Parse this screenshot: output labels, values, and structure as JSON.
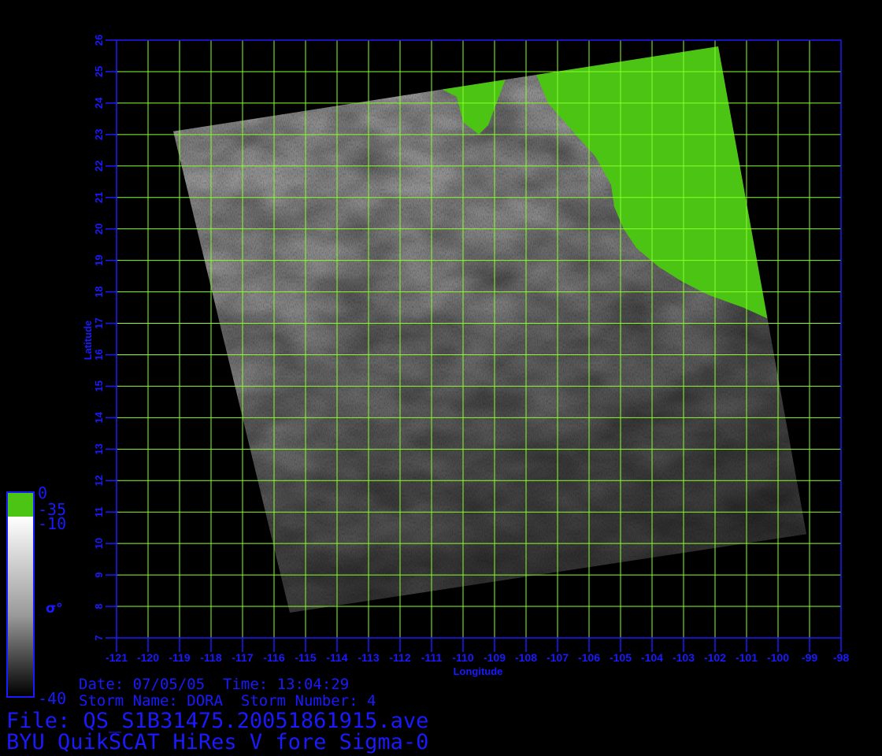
{
  "map": {
    "lon_ticks": [
      "-121",
      "-120",
      "-119",
      "-118",
      "-117",
      "-116",
      "-115",
      "-114",
      "-113",
      "-112",
      "-111",
      "-110",
      "-109",
      "-108",
      "-107",
      "-106",
      "-105",
      "-104",
      "-103",
      "-102",
      "-101",
      "-100",
      "-99",
      "-98"
    ],
    "lat_ticks": [
      "7",
      "8",
      "9",
      "10",
      "11",
      "12",
      "13",
      "14",
      "15",
      "16",
      "17",
      "18",
      "19",
      "20",
      "21",
      "22",
      "23",
      "24",
      "25",
      "26"
    ],
    "x_label": "Longitude",
    "y_label": "Latitude",
    "grid_color": "#8aff2a",
    "axis_color": "#1a1aff",
    "land_color": "#4cc414",
    "lon_range": [
      -121,
      -98
    ],
    "lat_range": [
      7,
      26
    ],
    "swath_corners_lonlat": [
      [
        -119.2,
        23.1
      ],
      [
        -101.9,
        25.8
      ],
      [
        -99.1,
        10.3
      ],
      [
        -115.5,
        7.8
      ]
    ]
  },
  "colorbar": {
    "label_0": "0",
    "label_neg35": "-35",
    "label_neg10": "-10",
    "label_neg40": "-40",
    "symbol": "σ°",
    "top_color": "#4cc414",
    "bottom_color": "#000000"
  },
  "info": {
    "date_line": "Date: 07/05/05  Time: 13:04:29",
    "storm_line": "Storm Name: DORA  Storm Number: 4",
    "file_line": "File: QS_S1B31475.20051861915.ave",
    "product_line": "BYU QuikSCAT HiRes V fore Sigma-0"
  }
}
